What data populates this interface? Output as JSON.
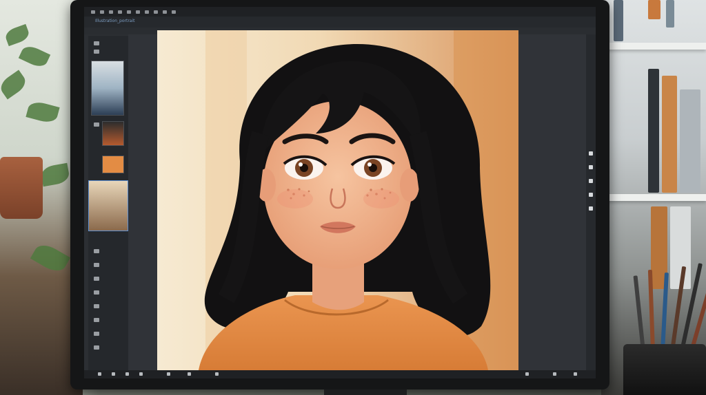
{
  "scene": {
    "subject": "digital-painting-software-on-monitor"
  },
  "app": {
    "document_title": "Illustration_portrait",
    "menu_labels": [
      "",
      "",
      "",
      "",
      "",
      "",
      ""
    ]
  },
  "colors": {
    "background_warm": "#f1d9b4",
    "curtain": "#e0a66e",
    "hair": "#121112",
    "skin": "#f0b089",
    "shirt": "#e38c44",
    "eyes": "#7a4424",
    "app_panel": "#25282c",
    "app_canvas_bg": "#303338"
  },
  "icons": {
    "tools": "brush-tool-icons",
    "rail": "panel-toggle-icons",
    "status": "status-bar-icons"
  }
}
